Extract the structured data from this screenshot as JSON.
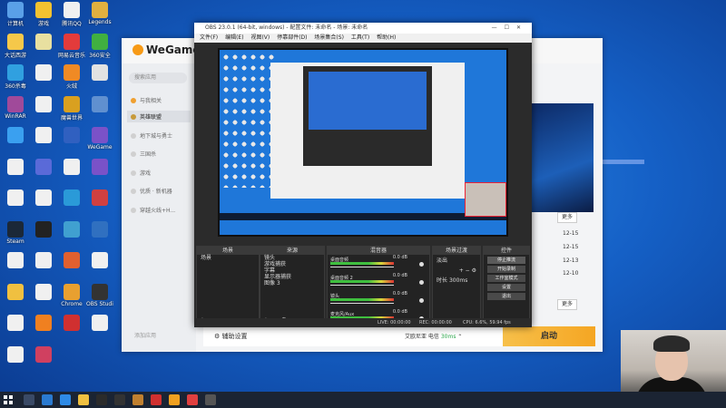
{
  "desktop": {
    "icons": [
      {
        "label": "计算机",
        "color": "#5aa0e8"
      },
      {
        "label": "游戏",
        "color": "#f2c230"
      },
      {
        "label": "腾讯QQ",
        "color": "#f0f0f0"
      },
      {
        "label": "Legends",
        "color": "#e0b040"
      },
      {
        "label": "大话西游",
        "color": "#f5c84a"
      },
      {
        "label": "",
        "color": "#e8e0a0"
      },
      {
        "label": "网易云音乐",
        "color": "#e33b3b"
      },
      {
        "label": "360安全",
        "color": "#40b040"
      },
      {
        "label": "360杀毒",
        "color": "#30a0e0"
      },
      {
        "label": "",
        "color": "#f0f0f0"
      },
      {
        "label": "火绒",
        "color": "#f08a24"
      },
      {
        "label": "",
        "color": "#e2e2e2"
      },
      {
        "label": "WinRAR",
        "color": "#a04a9a"
      },
      {
        "label": "",
        "color": "#f0f0f0"
      },
      {
        "label": "魔兽世界",
        "color": "#d9a020"
      },
      {
        "label": "",
        "color": "#6090d0"
      },
      {
        "label": "",
        "color": "#3aa0f0"
      },
      {
        "label": "",
        "color": "#f0f0f0"
      },
      {
        "label": "",
        "color": "#3060c0"
      },
      {
        "label": "WeGame",
        "color": "#7a52c8"
      },
      {
        "label": "",
        "color": "#f0f0f0"
      },
      {
        "label": "",
        "color": "#5a6ad8"
      },
      {
        "label": "",
        "color": "#f0f0f0"
      },
      {
        "label": "",
        "color": "#7a52c8"
      },
      {
        "label": "",
        "color": "#f0f0f0"
      },
      {
        "label": "",
        "color": "#f0f0f0"
      },
      {
        "label": "",
        "color": "#2a9ad8"
      },
      {
        "label": "",
        "color": "#d04040"
      },
      {
        "label": "Steam",
        "color": "#1b2838"
      },
      {
        "label": "",
        "color": "#222222"
      },
      {
        "label": "",
        "color": "#40a0d0"
      },
      {
        "label": "",
        "color": "#3070c0"
      },
      {
        "label": "",
        "color": "#f0f0f0"
      },
      {
        "label": "",
        "color": "#f0f0f0"
      },
      {
        "label": "",
        "color": "#e06030"
      },
      {
        "label": "",
        "color": "#f0f0f0"
      },
      {
        "label": "",
        "color": "#f0c040"
      },
      {
        "label": "",
        "color": "#f0f0f0"
      },
      {
        "label": "Chrome",
        "color": "#e8a030"
      },
      {
        "label": "OBS Studio",
        "color": "#333333"
      },
      {
        "label": "",
        "color": "#f0f0f0"
      },
      {
        "label": "",
        "color": "#f08020"
      },
      {
        "label": "",
        "color": "#d03030"
      },
      {
        "label": "",
        "color": "#f0f0f0"
      },
      {
        "label": "",
        "color": "#f0f0f0"
      },
      {
        "label": "",
        "color": "#d04060"
      }
    ]
  },
  "wegame": {
    "logo": "WeGame",
    "search_placeholder": "搜索应用",
    "nav": [
      "与我相关",
      "英雄联盟",
      "地下城与勇士",
      "三国杀",
      "游戏",
      "优质 · 新机器",
      "穿越火线+H..."
    ],
    "footer": "添加应用",
    "dates": [
      "12-15",
      "12-15",
      "12-13",
      "12-10"
    ],
    "more_label": "更多",
    "more_label_2": "更多",
    "bottom": {
      "assist_label": "辅助设置",
      "region_label": "艾欧尼亚 电信",
      "status": "30ms",
      "launch_label": "启动"
    }
  },
  "obs": {
    "title": "OBS 23.0.1 (64-bit, windows) - 配置文件: 未命名 - 场景: 未命名",
    "menu": [
      "文件(F)",
      "编辑(E)",
      "视图(V)",
      "停靠部件(D)",
      "场景集合(S)",
      "工具(T)",
      "帮助(H)"
    ],
    "docks": {
      "scenes": {
        "title": "场景",
        "items": [
          "场景"
        ]
      },
      "sources": {
        "title": "来源",
        "items": [
          "镜头",
          "游戏捕获",
          "字幕",
          "显示器捕获",
          "图像 3"
        ]
      },
      "mixer": {
        "title": "混音器",
        "rows": [
          {
            "name": "桌面音频",
            "db": "0.0 dB"
          },
          {
            "name": "桌面音频 2",
            "db": "0.0 dB"
          },
          {
            "name": "镜头",
            "db": "0.0 dB"
          },
          {
            "name": "麦克风/Aux",
            "db": "0.0 dB"
          }
        ]
      },
      "transitions": {
        "title": "场景过渡",
        "type": "淡出",
        "duration_label": "时长",
        "duration": "300ms"
      },
      "controls": {
        "title": "控件",
        "buttons": [
          "停止推流",
          "开始录制",
          "工作室模式",
          "设置",
          "退出"
        ]
      }
    },
    "status": {
      "live": "LIVE: 00:00:00",
      "rec": "REC: 00:00:00",
      "cpu": "CPU: 6.6%, 59.94 fps"
    }
  },
  "colors": {
    "obs_bg": "#2b2b2b",
    "wegame_accent": "#f5a623",
    "desktop_blue": "#1560c6"
  }
}
